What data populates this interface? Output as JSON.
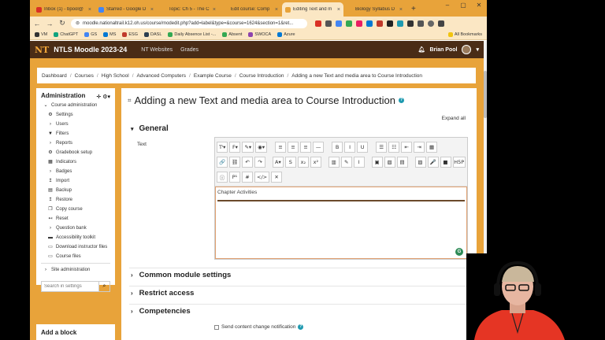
{
  "tabs": [
    {
      "label": "Inbox (1) - bpool@",
      "color": "#d93025",
      "active": false
    },
    {
      "label": "Starred - Google D",
      "color": "#4285f4",
      "active": false
    },
    {
      "label": "Topic: Ch 5 - The C",
      "color": "#e8a33a",
      "active": false
    },
    {
      "label": "Edit course: Comp",
      "color": "#e8a33a",
      "active": false
    },
    {
      "label": "Editing Text and m",
      "color": "#e8a33a",
      "active": true
    },
    {
      "label": "Biology Syllabus D",
      "color": "#e8a33a",
      "active": false
    }
  ],
  "address": {
    "url": "moodle.nationaltrail.k12.oh.us/course/modedit.php?add=label&type=&course=1624&section=1&ret..."
  },
  "bookmarks": [
    {
      "label": "VM",
      "color": "#333"
    },
    {
      "label": "ChatGPT",
      "color": "#10a37f"
    },
    {
      "label": "GS",
      "color": "#4285f4"
    },
    {
      "label": "MS",
      "color": "#0078d4"
    },
    {
      "label": "ESG",
      "color": "#c0392b"
    },
    {
      "label": "DASL",
      "color": "#2c3e50"
    },
    {
      "label": "Daily Absence List -...",
      "color": "#34a853"
    },
    {
      "label": "Absent",
      "color": "#34a853"
    },
    {
      "label": "SWOCA",
      "color": "#8e44ad"
    },
    {
      "label": "Azure",
      "color": "#0078d4"
    },
    {
      "label": "All Bookmarks",
      "color": "#f1c40f"
    }
  ],
  "moodle": {
    "logo": "NT",
    "site_name": "NTLS Moodle 2023-24",
    "nav": [
      "NT Websites",
      "Grades"
    ],
    "user": "Brian Pool"
  },
  "breadcrumb": [
    "Dashboard",
    "Courses",
    "High School",
    "Advanced Computers",
    "Example Course",
    "Course Introduction",
    "Adding a new Text and media area to Course Introduction"
  ],
  "sidebar": {
    "title": "Administration",
    "course_admin": "Course administration",
    "items": [
      {
        "label": "Settings",
        "icon": "gear-icon",
        "glyph": "⚙"
      },
      {
        "label": "Users",
        "icon": "chevron-right-icon",
        "glyph": "›"
      },
      {
        "label": "Filters",
        "icon": "filter-icon",
        "glyph": "▼"
      },
      {
        "label": "Reports",
        "icon": "chevron-right-icon",
        "glyph": "›"
      },
      {
        "label": "Gradebook setup",
        "icon": "gear-icon",
        "glyph": "⚙"
      },
      {
        "label": "Indicators",
        "icon": "indicator-icon",
        "glyph": "▦"
      },
      {
        "label": "Badges",
        "icon": "chevron-right-icon",
        "glyph": "›"
      },
      {
        "label": "Import",
        "icon": "import-icon",
        "glyph": "↥"
      },
      {
        "label": "Backup",
        "icon": "backup-icon",
        "glyph": "▤"
      },
      {
        "label": "Restore",
        "icon": "restore-icon",
        "glyph": "↥"
      },
      {
        "label": "Copy course",
        "icon": "copy-icon",
        "glyph": "❐"
      },
      {
        "label": "Reset",
        "icon": "reset-icon",
        "glyph": "↤"
      },
      {
        "label": "Question bank",
        "icon": "chevron-right-icon",
        "glyph": "›"
      },
      {
        "label": "Accessibility toolkit",
        "icon": "accessibility-icon",
        "glyph": "▬"
      },
      {
        "label": "Download instructor files",
        "icon": "download-icon",
        "glyph": "▭"
      },
      {
        "label": "Course files",
        "icon": "files-icon",
        "glyph": "▭"
      }
    ],
    "site_admin": "Site administration",
    "search_placeholder": "Search in settings",
    "add_block": "Add a block"
  },
  "main": {
    "title": "Adding a new Text and media area to Course Introduction",
    "expand_all": "Expand all",
    "general": "General",
    "text_label": "Text",
    "editor_text": "Chapter Activities",
    "sections": [
      "Common module settings",
      "Restrict access",
      "Competencies"
    ],
    "notify_label": "Send content change notification"
  },
  "toolbar": {
    "row1": [
      "Tᴵ▾",
      "F▾",
      "✎▾",
      "◉▾",
      "≡",
      "≡",
      "≡",
      "—",
      "B",
      "I",
      "U",
      "☰",
      "☷",
      "⇤",
      "⇥",
      "▦"
    ],
    "row2": [
      "🔗",
      "⛓",
      "↶",
      "↷",
      "A▾",
      "S",
      "x₂",
      "x²",
      "▥",
      "✎",
      "I",
      "▣",
      "▧",
      "▤",
      "▨",
      "🎤",
      "■",
      "H5P"
    ],
    "row3": [
      "ⓘ",
      "P¹",
      "#",
      "</>",
      "✕"
    ]
  },
  "colors": {
    "accent": "#e8a33a",
    "header": "#4a2c16",
    "help": "#1f9ab0"
  }
}
